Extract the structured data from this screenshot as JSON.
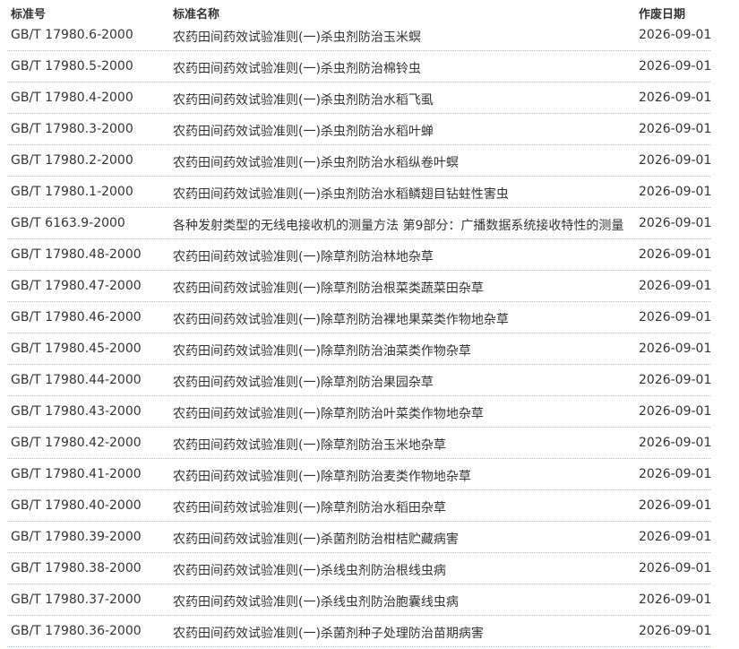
{
  "header": {
    "code": "标准号",
    "name": "标准名称",
    "date": "作废日期"
  },
  "rows": [
    {
      "code": "GB/T 17980.6-2000",
      "name": "农药田间药效试验准则(一)杀虫剂防治玉米螟",
      "date": "2026-09-01"
    },
    {
      "code": "GB/T 17980.5-2000",
      "name": "农药田间药效试验准则(一)杀虫剂防治棉铃虫",
      "date": "2026-09-01"
    },
    {
      "code": "GB/T 17980.4-2000",
      "name": "农药田间药效试验准则(一)杀虫剂防治水稻飞虱",
      "date": "2026-09-01"
    },
    {
      "code": "GB/T 17980.3-2000",
      "name": "农药田间药效试验准则(一)杀虫剂防治水稻叶蝉",
      "date": "2026-09-01"
    },
    {
      "code": "GB/T 17980.2-2000",
      "name": "农药田间药效试验准则(一)杀虫剂防治水稻纵卷叶螟",
      "date": "2026-09-01"
    },
    {
      "code": "GB/T 17980.1-2000",
      "name": "农药田间药效试验准则(一)杀虫剂防治水稻鳞翅目钻蛀性害虫",
      "date": "2026-09-01"
    },
    {
      "code": "GB/T 6163.9-2000",
      "name": "各种发射类型的无线电接收机的测量方法 第9部分：广播数据系统接收特性的测量",
      "date": "2026-09-01"
    },
    {
      "code": "GB/T 17980.48-2000",
      "name": "农药田间药效试验准则(一)除草剂防治林地杂草",
      "date": "2026-09-01"
    },
    {
      "code": "GB/T 17980.47-2000",
      "name": "农药田间药效试验准则(一)除草剂防治根菜类蔬菜田杂草",
      "date": "2026-09-01"
    },
    {
      "code": "GB/T 17980.46-2000",
      "name": "农药田间药效试验准则(一)除草剂防治裸地果菜类作物地杂草",
      "date": "2026-09-01"
    },
    {
      "code": "GB/T 17980.45-2000",
      "name": "农药田间药效试验准则(一)除草剂防治油菜类作物杂草",
      "date": "2026-09-01"
    },
    {
      "code": "GB/T 17980.44-2000",
      "name": "农药田间药效试验准则(一)除草剂防治果园杂草",
      "date": "2026-09-01"
    },
    {
      "code": "GB/T 17980.43-2000",
      "name": "农药田间药效试验准则(一)除草剂防治叶菜类作物地杂草",
      "date": "2026-09-01"
    },
    {
      "code": "GB/T 17980.42-2000",
      "name": "农药田间药效试验准则(一)除草剂防治玉米地杂草",
      "date": "2026-09-01"
    },
    {
      "code": "GB/T 17980.41-2000",
      "name": "农药田间药效试验准则(一)除草剂防治麦类作物地杂草",
      "date": "2026-09-01"
    },
    {
      "code": "GB/T 17980.40-2000",
      "name": "农药田间药效试验准则(一)除草剂防治水稻田杂草",
      "date": "2026-09-01"
    },
    {
      "code": "GB/T 17980.39-2000",
      "name": "农药田间药效试验准则(一)杀菌剂防治柑桔贮藏病害",
      "date": "2026-09-01"
    },
    {
      "code": "GB/T 17980.38-2000",
      "name": "农药田间药效试验准则(一)杀线虫剂防治根线虫病",
      "date": "2026-09-01"
    },
    {
      "code": "GB/T 17980.37-2000",
      "name": "农药田间药效试验准则(一)杀线虫剂防治胞囊线虫病",
      "date": "2026-09-01"
    },
    {
      "code": "GB/T 17980.36-2000",
      "name": "农药田间药效试验准则(一)杀菌剂种子处理防治苗期病害",
      "date": "2026-09-01"
    }
  ]
}
